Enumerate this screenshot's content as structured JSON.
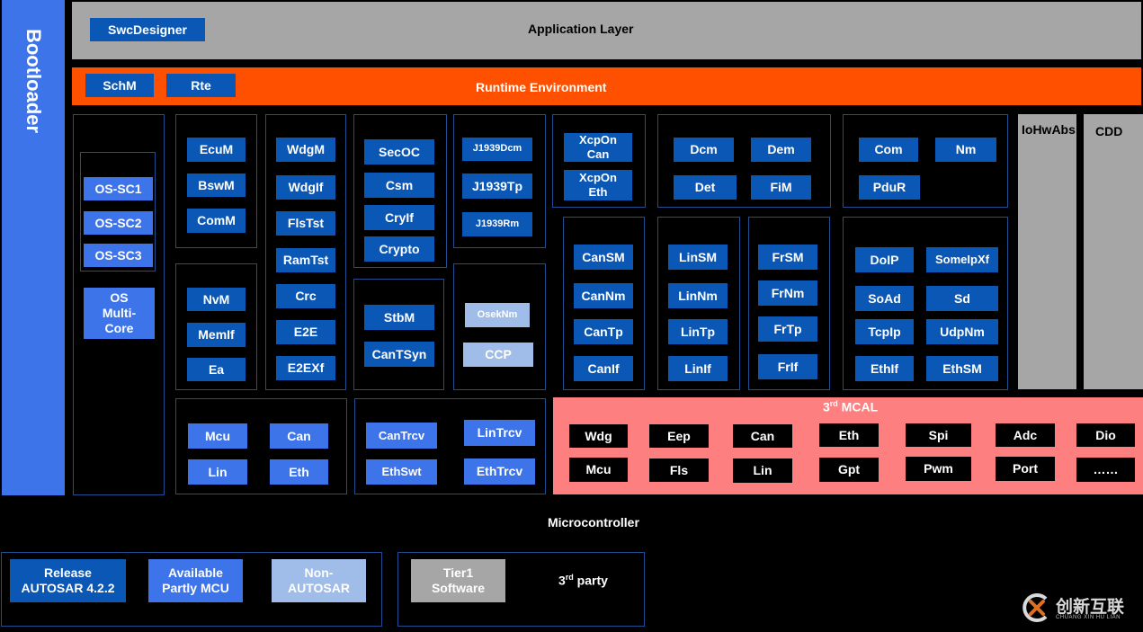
{
  "bootloader": "Bootloader",
  "app_layer": {
    "title": "Application Layer",
    "swc": "SwcDesigner"
  },
  "rte": {
    "title": "Runtime Environment",
    "schm": "SchM",
    "rte": "Rte"
  },
  "os": {
    "sc1": "OS-SC1",
    "sc2": "OS-SC2",
    "sc3": "OS-SC3",
    "multicore": "OS Multi-Core"
  },
  "system": {
    "ecum": "EcuM",
    "bswm": "BswM",
    "comm": "ComM"
  },
  "memory": {
    "nvm": "NvM",
    "memif": "MemIf",
    "ea": "Ea"
  },
  "wdg_group": {
    "wdgm": "WdgM",
    "wdgif": "WdgIf",
    "flstst": "FlsTst",
    "ramtst": "RamTst",
    "crc": "Crc",
    "e2e": "E2E",
    "e2exf": "E2EXf"
  },
  "security": {
    "secoc": "SecOC",
    "csm": "Csm",
    "cryif": "CryIf",
    "crypto": "Crypto"
  },
  "sync": {
    "stbm": "StbM",
    "cantsyn": "CanTSyn"
  },
  "j1939": {
    "dcm": "J1939Dcm",
    "tp": "J1939Tp",
    "rm": "J1939Rm"
  },
  "osek": {
    "oseknm": "OsekNm",
    "ccp": "CCP"
  },
  "xcp": {
    "can": "XcpOn Can",
    "eth": "XcpOn Eth"
  },
  "diag": {
    "dcm": "Dcm",
    "dem": "Dem",
    "det": "Det",
    "fim": "FiM"
  },
  "com": {
    "com": "Com",
    "nm": "Nm",
    "pdur": "PduR"
  },
  "can_stack": {
    "cansm": "CanSM",
    "cannm": "CanNm",
    "cantp": "CanTp",
    "canif": "CanIf"
  },
  "lin_stack": {
    "linsm": "LinSM",
    "linnm": "LinNm",
    "lintp": "LinTp",
    "linif": "LinIf"
  },
  "fr_stack": {
    "frsm": "FrSM",
    "frnm": "FrNm",
    "frtp": "FrTp",
    "frif": "FrIf"
  },
  "eth_stack": {
    "doip": "DoIP",
    "someipxf": "SomeIpXf",
    "soad": "SoAd",
    "sd": "Sd",
    "tcpip": "TcpIp",
    "udpnm": "UdpNm",
    "ethif": "EthIf",
    "ethsm": "EthSM"
  },
  "iohwabs": "IoHwAbs",
  "cdd": "CDD",
  "mcal_stub": {
    "mcu": "Mcu",
    "can": "Can",
    "lin": "Lin",
    "eth": "Eth"
  },
  "trcv": {
    "cantrcv": "CanTrcv",
    "lintrcv": "LinTrcv",
    "ethswt": "EthSwt",
    "ethtrcv": "EthTrcv"
  },
  "mcal3": {
    "title_pre": "3",
    "title_sup": "rd",
    "title_post": " MCAL",
    "row1": [
      "Wdg",
      "Eep",
      "Can",
      "Eth",
      "Spi",
      "Adc",
      "Dio"
    ],
    "row2": [
      "Mcu",
      "Fls",
      "Lin",
      "Gpt",
      "Pwm",
      "Port",
      "……"
    ]
  },
  "microcontroller": "Microcontroller",
  "legend": {
    "release": "Release AUTOSAR 4.2.2",
    "available": "Available Partly MCU",
    "non": "Non-AUTOSAR",
    "tier1": "Tier1 Software",
    "third_pre": "3",
    "third_sup": "rd",
    "third_post": " party"
  },
  "logo": {
    "cn": "创新互联",
    "pinyin": "CHUANG XIN HU LIAN"
  },
  "colors": {
    "release": "#0b57b5",
    "available": "#3d74ea",
    "non_autosar": "#a0bde9",
    "tier1": "#a6a6a6",
    "rte": "#ff5000",
    "mcal": "#fe7f7f",
    "app": "#a6a6a6",
    "bootloader": "#3d74ea"
  }
}
